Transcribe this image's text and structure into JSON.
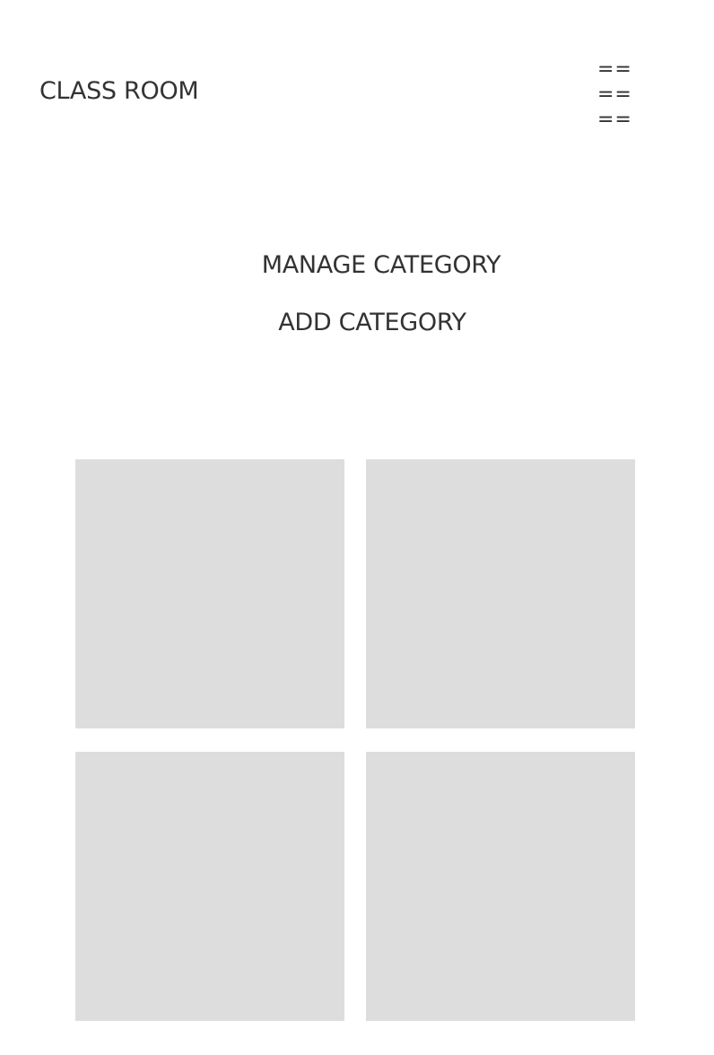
{
  "header": {
    "brand": "CLASS ROOM",
    "menu_icon": "hamburger-icon",
    "menu_rows": [
      "==",
      "==",
      "=="
    ]
  },
  "main": {
    "title": "MANAGE CATEGORY",
    "add_label": "ADD CATEGORY"
  },
  "grid": {
    "tile_color": "#dddddd",
    "tiles": [
      {
        "label": ""
      },
      {
        "label": ""
      },
      {
        "label": ""
      },
      {
        "label": ""
      }
    ]
  }
}
